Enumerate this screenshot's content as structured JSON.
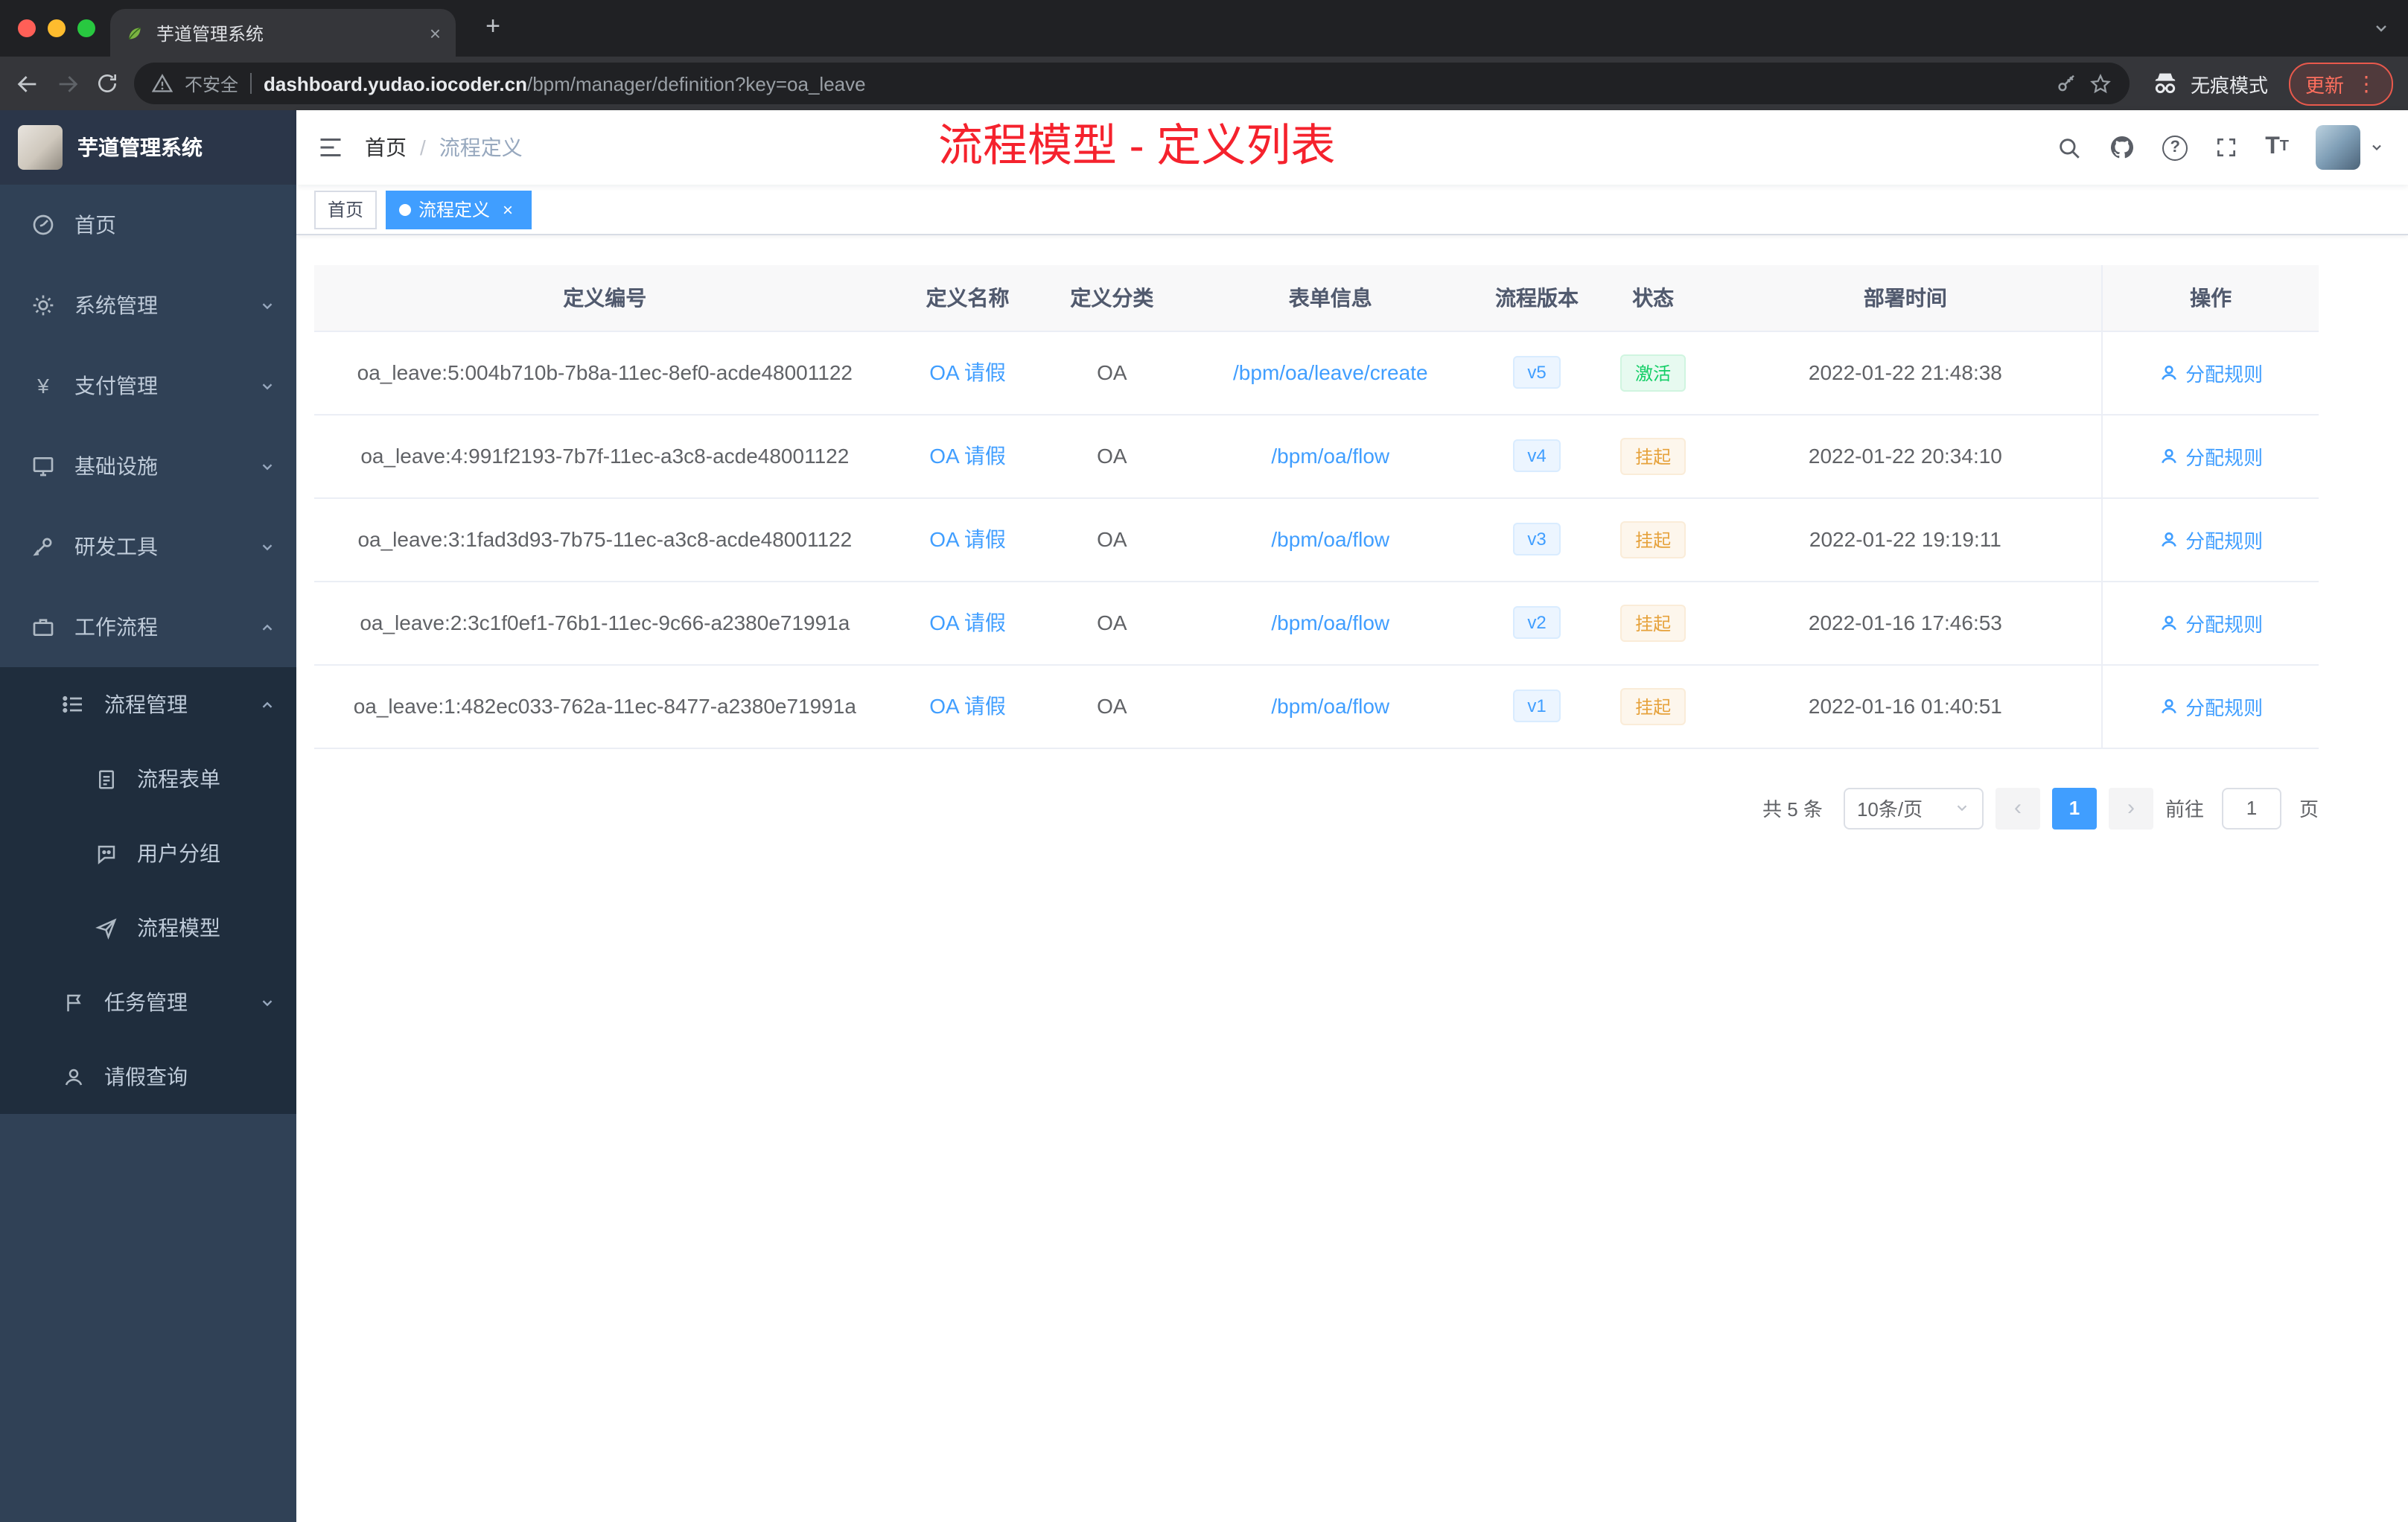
{
  "colors": {
    "accent": "#409eff",
    "annotation_red": "#f5222d",
    "status_active_green": "#13ce66",
    "status_suspended_orange": "#e6a23c",
    "sidebar_bg": "#304156",
    "submenu_bg": "#1f2d3d",
    "active_tag_bg": "#409eff"
  },
  "glyphs": {
    "close": "×",
    "add": "+",
    "more": "⋮",
    "prev": "‹",
    "next": "›",
    "help": "?",
    "yen": "¥",
    "font_size": "T"
  },
  "browser": {
    "tab": {
      "title": "芋道管理系统"
    },
    "address": {
      "security_label": "不安全",
      "domain": "dashboard.yudao.iocoder.cn",
      "path": "/bpm/manager/definition?key=oa_leave"
    },
    "incognito_label": "无痕模式",
    "update_label": "更新"
  },
  "sidebar": {
    "logo_title": "芋道管理系统",
    "items": [
      {
        "label": "首页",
        "icon": "dashboard-icon"
      },
      {
        "label": "系统管理",
        "icon": "gear-icon"
      },
      {
        "label": "支付管理",
        "icon": "yen-icon"
      },
      {
        "label": "基础设施",
        "icon": "monitor-icon"
      },
      {
        "label": "研发工具",
        "icon": "wrench-icon"
      },
      {
        "label": "工作流程",
        "icon": "briefcase-icon"
      }
    ],
    "submenu": {
      "process_mgmt": {
        "label": "流程管理",
        "icon": "list-icon"
      },
      "children": [
        {
          "label": "流程表单",
          "icon": "form-icon"
        },
        {
          "label": "用户分组",
          "icon": "chat-group-icon"
        },
        {
          "label": "流程模型",
          "icon": "paper-plane-icon"
        }
      ],
      "task_mgmt": {
        "label": "任务管理",
        "icon": "flag-icon"
      },
      "leave_query": {
        "label": "请假查询",
        "icon": "person-icon"
      }
    }
  },
  "navbar": {
    "breadcrumb": {
      "home": "首页",
      "sep": "/",
      "current": "流程定义"
    },
    "annotation": "流程模型 - 定义列表"
  },
  "tags": [
    {
      "label": "首页"
    },
    {
      "label": "流程定义"
    }
  ],
  "table": {
    "headers": [
      "定义编号",
      "定义名称",
      "定义分类",
      "表单信息",
      "流程版本",
      "状态",
      "部署时间",
      "操作"
    ],
    "rows": [
      {
        "id": "oa_leave:5:004b710b-7b8a-11ec-8ef0-acde48001122",
        "name": "OA 请假",
        "category": "OA",
        "form": "/bpm/oa/leave/create",
        "version": "v5",
        "status": "激活",
        "status_type": "success",
        "time": "2022-01-22 21:48:38",
        "action": "分配规则"
      },
      {
        "id": "oa_leave:4:991f2193-7b7f-11ec-a3c8-acde48001122",
        "name": "OA 请假",
        "category": "OA",
        "form": "/bpm/oa/flow",
        "version": "v4",
        "status": "挂起",
        "status_type": "warning",
        "time": "2022-01-22 20:34:10",
        "action": "分配规则"
      },
      {
        "id": "oa_leave:3:1fad3d93-7b75-11ec-a3c8-acde48001122",
        "name": "OA 请假",
        "category": "OA",
        "form": "/bpm/oa/flow",
        "version": "v3",
        "status": "挂起",
        "status_type": "warning",
        "time": "2022-01-22 19:19:11",
        "action": "分配规则"
      },
      {
        "id": "oa_leave:2:3c1f0ef1-76b1-11ec-9c66-a2380e71991a",
        "name": "OA 请假",
        "category": "OA",
        "form": "/bpm/oa/flow",
        "version": "v2",
        "status": "挂起",
        "status_type": "warning",
        "time": "2022-01-16 17:46:53",
        "action": "分配规则"
      },
      {
        "id": "oa_leave:1:482ec033-762a-11ec-8477-a2380e71991a",
        "name": "OA 请假",
        "category": "OA",
        "form": "/bpm/oa/flow",
        "version": "v1",
        "status": "挂起",
        "status_type": "warning",
        "time": "2022-01-16 01:40:51",
        "action": "分配规则"
      }
    ]
  },
  "pagination": {
    "total": "共 5 条",
    "page_size": "10条/页",
    "current_page": "1",
    "goto_label": "前往",
    "goto_value": "1",
    "page_unit": "页"
  }
}
